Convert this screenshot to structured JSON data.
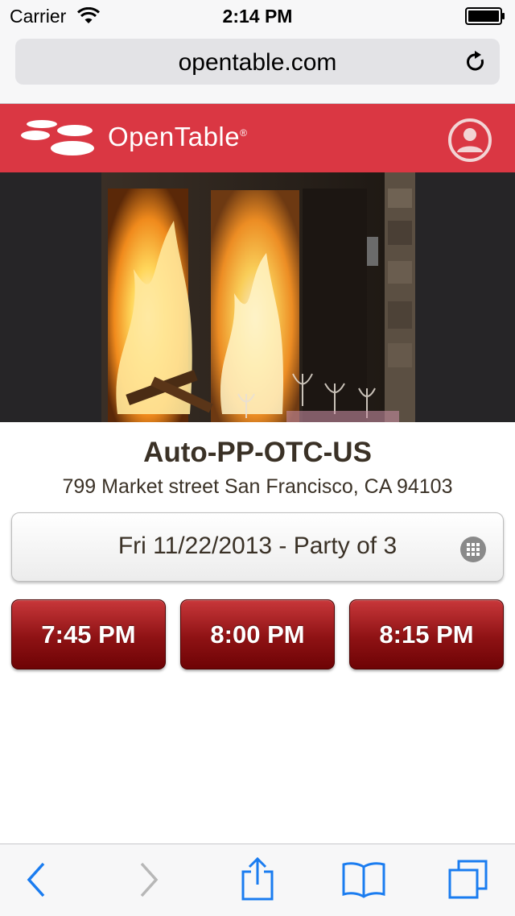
{
  "status_bar": {
    "carrier": "Carrier",
    "time": "2:14 PM",
    "icons": [
      "wifi-icon",
      "battery-icon"
    ]
  },
  "browser": {
    "url": "opentable.com",
    "icons": [
      "reload-icon"
    ]
  },
  "header": {
    "brand": "OpenTable",
    "brand_mark": "®",
    "brand_color": "#da3743",
    "icons": [
      "opentable-logo-icon",
      "profile-icon"
    ]
  },
  "restaurant": {
    "name": "Auto-PP-OTC-US",
    "address": "799 Market street San Francisco, CA 94103"
  },
  "booking": {
    "selection": "Fri 11/22/2013 - Party of 3",
    "icons": [
      "calendar-grid-icon"
    ]
  },
  "time_slots": [
    {
      "label": "7:45 PM"
    },
    {
      "label": "8:00 PM"
    },
    {
      "label": "8:15 PM"
    }
  ],
  "toolbar": {
    "buttons": [
      "back-icon",
      "forward-icon",
      "share-icon",
      "bookmarks-icon",
      "tabs-icon"
    ],
    "accent_color": "#1a7cf0"
  }
}
